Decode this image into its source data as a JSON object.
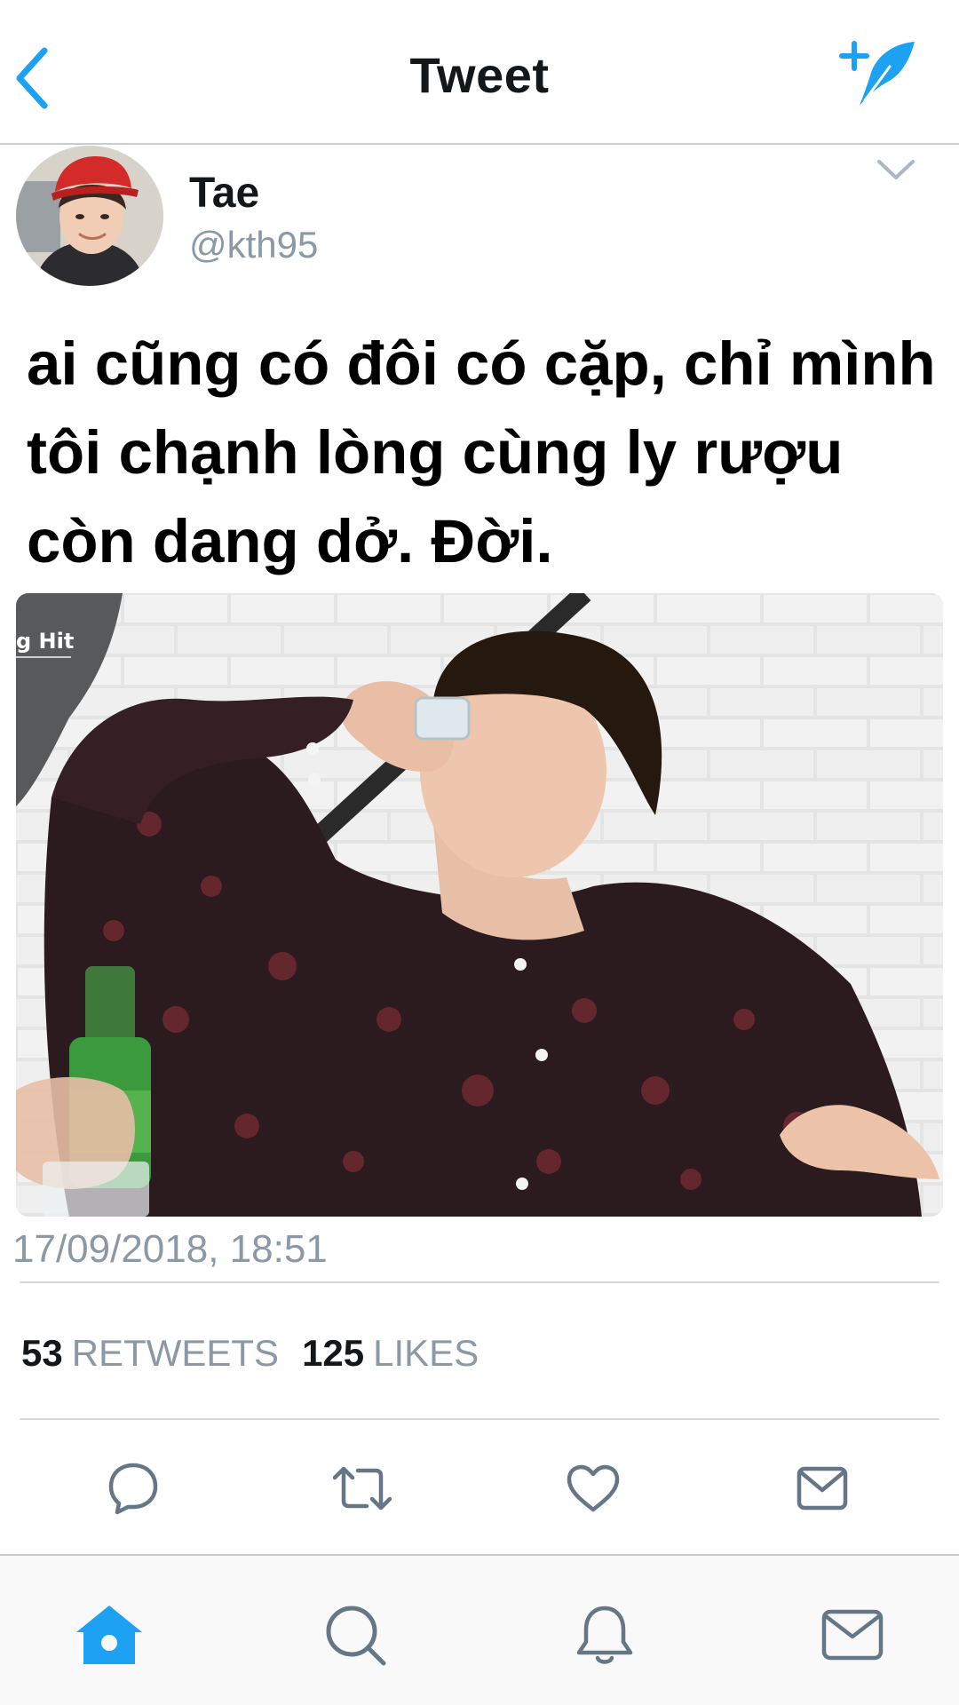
{
  "header": {
    "title": "Tweet",
    "back_icon": "chevron-left-icon",
    "compose_icon": "compose-tweet-icon"
  },
  "author": {
    "name": "Tae",
    "handle": "@kth95"
  },
  "tweet": {
    "text": "ai cũng có đôi có cặp, chỉ mình tôi chạnh lòng cùng ly rượu còn dang dở. Đời.",
    "timestamp": "17/09/2018, 18:51"
  },
  "stats": {
    "retweets_count": "53",
    "retweets_label": "RETWEETS",
    "likes_count": "125",
    "likes_label": "LIKES"
  },
  "actions": [
    "reply-icon",
    "retweet-icon",
    "like-icon",
    "direct-message-icon"
  ],
  "tabbar": {
    "tabs": [
      "home-icon",
      "search-icon",
      "notifications-icon",
      "messages-icon"
    ],
    "active_tab": "home"
  },
  "colors": {
    "accent": "#1da1f2",
    "icon_gray": "#657786",
    "secondary_text": "#8b98a5",
    "divider": "#d6dadd"
  }
}
